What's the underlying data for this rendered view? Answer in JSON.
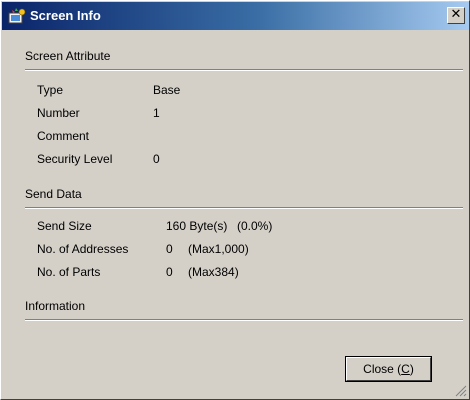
{
  "window": {
    "title": "Screen Info",
    "close_glyph": "✕"
  },
  "screen_attribute": {
    "heading": "Screen Attribute",
    "type_label": "Type",
    "type_value": "Base",
    "number_label": "Number",
    "number_value": "1",
    "comment_label": "Comment",
    "comment_value": "",
    "security_label": "Security Level",
    "security_value": "0"
  },
  "send_data": {
    "heading": "Send Data",
    "size_label": "Send Size",
    "size_value": "160 Byte(s)",
    "size_pct": "(0.0%)",
    "addresses_label": "No. of Addresses",
    "addresses_value": "0",
    "addresses_max": "(Max1,000)",
    "parts_label": "No. of Parts",
    "parts_value": "0",
    "parts_max": "(Max384)"
  },
  "information": {
    "heading": "Information"
  },
  "buttons": {
    "close_label": "Close (",
    "close_key": "C",
    "close_end": ")"
  },
  "icons": {
    "title_icon": "screen-info-icon",
    "close_icon": "close-icon",
    "grip_icon": "resize-grip-icon"
  }
}
